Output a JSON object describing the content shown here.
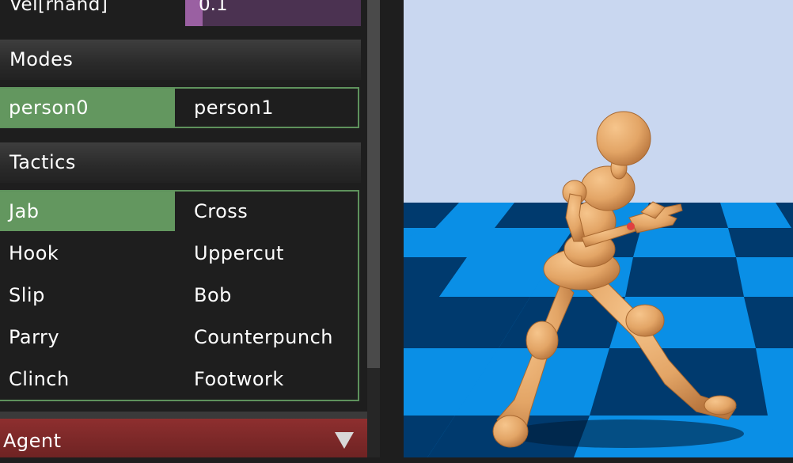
{
  "slider": {
    "label": "Vel[rhand]",
    "value": "0.1",
    "fraction": 0.1
  },
  "modes": {
    "title": "Modes",
    "options": [
      "person0",
      "person1"
    ],
    "selected": "person0"
  },
  "tactics": {
    "title": "Tactics",
    "options": [
      "Jab",
      "Cross",
      "Hook",
      "Uppercut",
      "Slip",
      "Bob",
      "Parry",
      "Counterpunch",
      "Clinch",
      "Footwork"
    ],
    "selected": "Jab"
  },
  "agent": {
    "label": "Agent"
  },
  "colors": {
    "selected_green": "#63975f",
    "group_border": "#5e925c",
    "slider_fill": "#9a60a2",
    "slider_track": "#4b3251",
    "agent_bar": "#8e2f2f",
    "sky": "#c9d7f0",
    "floor_light": "#0a8fe6",
    "floor_dark": "#003a6e",
    "figure": "#e3a566"
  },
  "icons": {
    "dropdown": "triangle-down-icon"
  }
}
